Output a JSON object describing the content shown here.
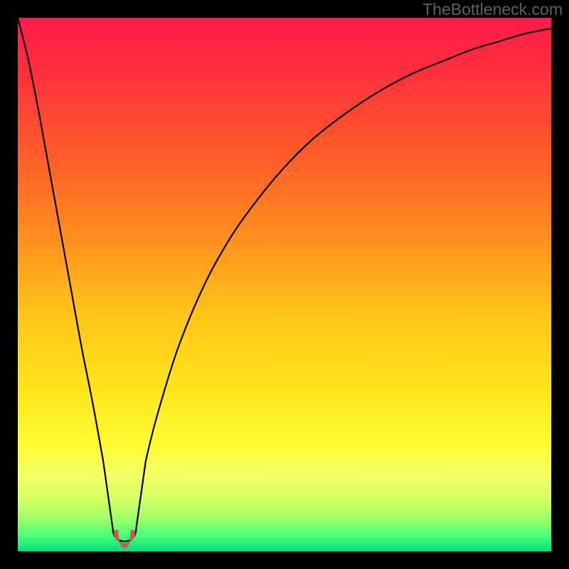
{
  "watermark": "TheBottleneck.com",
  "gradient": {
    "stops": [
      {
        "offset": 0.0,
        "color": "#ff1a4b"
      },
      {
        "offset": 0.1,
        "color": "#ff2f3c"
      },
      {
        "offset": 0.25,
        "color": "#ff5a2a"
      },
      {
        "offset": 0.4,
        "color": "#ff8a1f"
      },
      {
        "offset": 0.55,
        "color": "#ffc21a"
      },
      {
        "offset": 0.7,
        "color": "#ffe61a"
      },
      {
        "offset": 0.8,
        "color": "#fffb33"
      },
      {
        "offset": 0.86,
        "color": "#f2ff66"
      },
      {
        "offset": 0.9,
        "color": "#d8ff66"
      },
      {
        "offset": 0.94,
        "color": "#9cff66"
      },
      {
        "offset": 0.97,
        "color": "#4dff7a"
      },
      {
        "offset": 1.0,
        "color": "#00e07a"
      }
    ]
  },
  "chart_data": {
    "type": "line",
    "title": "",
    "xlabel": "",
    "ylabel": "",
    "xlim": [
      0,
      100
    ],
    "ylim": [
      0,
      100
    ],
    "x_min_at": 20,
    "dip_radius": 2.2,
    "dip_depth": 2.3,
    "marker": {
      "x": 20,
      "y": 1.5,
      "color": "#c85a5a",
      "size": 3.2
    },
    "series": [
      {
        "name": "bottleneck-curve",
        "x": [
          0,
          2,
          4,
          6,
          8,
          10,
          12,
          14,
          16,
          17.8,
          18.8,
          20,
          21.2,
          22.2,
          24,
          26,
          30,
          35,
          40,
          45,
          50,
          55,
          60,
          65,
          70,
          75,
          80,
          85,
          90,
          95,
          100
        ],
        "values": [
          100,
          92,
          82,
          71,
          60,
          49,
          38,
          28,
          17,
          8.0,
          3.5,
          1.5,
          3.5,
          8.0,
          17,
          25,
          38,
          50,
          59,
          66,
          72,
          77,
          81,
          84.5,
          87.5,
          90,
          92,
          94,
          95.5,
          97,
          98
        ]
      }
    ]
  }
}
